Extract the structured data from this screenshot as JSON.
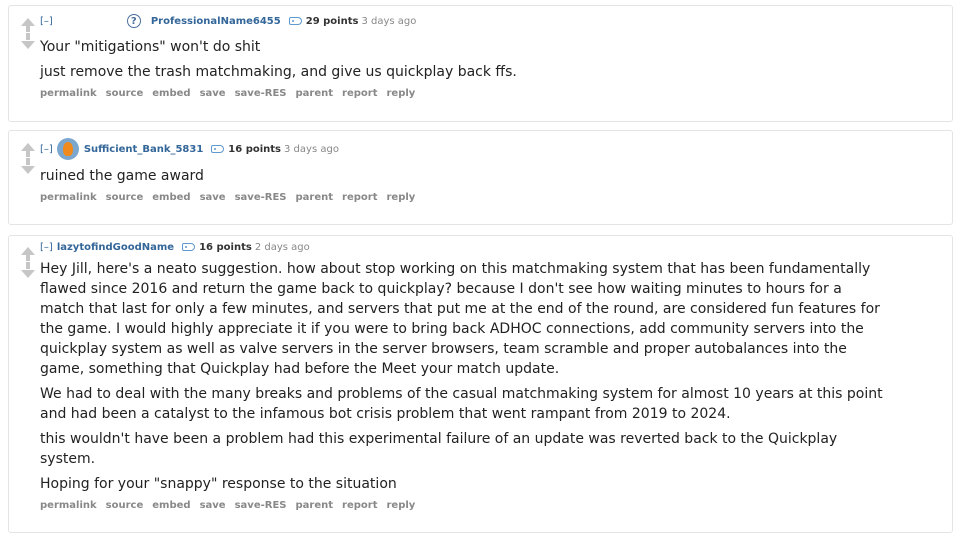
{
  "ui": {
    "expand_label": "[–]",
    "help_glyph": "?"
  },
  "comments": [
    {
      "author": "ProfessionalName6455",
      "points": "29 points",
      "time": "3 days ago",
      "paragraphs": [
        "Your \"mitigations\" won't do shit",
        "just remove the trash matchmaking, and give us quickplay back ffs."
      ],
      "buttons": [
        "permalink",
        "source",
        "embed",
        "save",
        "save-RES",
        "parent",
        "report",
        "reply"
      ]
    },
    {
      "author": "Sufficient_Bank_5831",
      "points": "16 points",
      "time": "3 days ago",
      "paragraphs": [
        "ruined the game award"
      ],
      "buttons": [
        "permalink",
        "source",
        "embed",
        "save",
        "save-RES",
        "parent",
        "report",
        "reply"
      ]
    },
    {
      "author": "lazytofindGoodName",
      "points": "16 points",
      "time": "2 days ago",
      "paragraphs": [
        "Hey Jill, here's a neato suggestion. how about stop working on this matchmaking system that has been fundamentally flawed since 2016 and return the game back to quickplay? because I don't see how waiting minutes to hours for a match that last for only a few minutes, and servers that put me at the end of the round, are considered fun features for the game. I would highly appreciate it if you were to bring back ADHOC connections, add community servers into the quickplay system as well as valve servers in the server browsers, team scramble and proper autobalances into the game, something that Quickplay had before the Meet your match update.",
        "We had to deal with the many breaks and problems of the casual matchmaking system for almost 10 years at this point and had been a catalyst to the infamous bot crisis problem that went rampant from 2019 to 2024.",
        "this wouldn't have been a problem had this experimental failure of an update was reverted back to the Quickplay system.",
        "Hoping for your \"snappy\" response to the situation"
      ],
      "buttons": [
        "permalink",
        "source",
        "embed",
        "save",
        "save-RES",
        "parent",
        "report",
        "reply"
      ]
    }
  ]
}
